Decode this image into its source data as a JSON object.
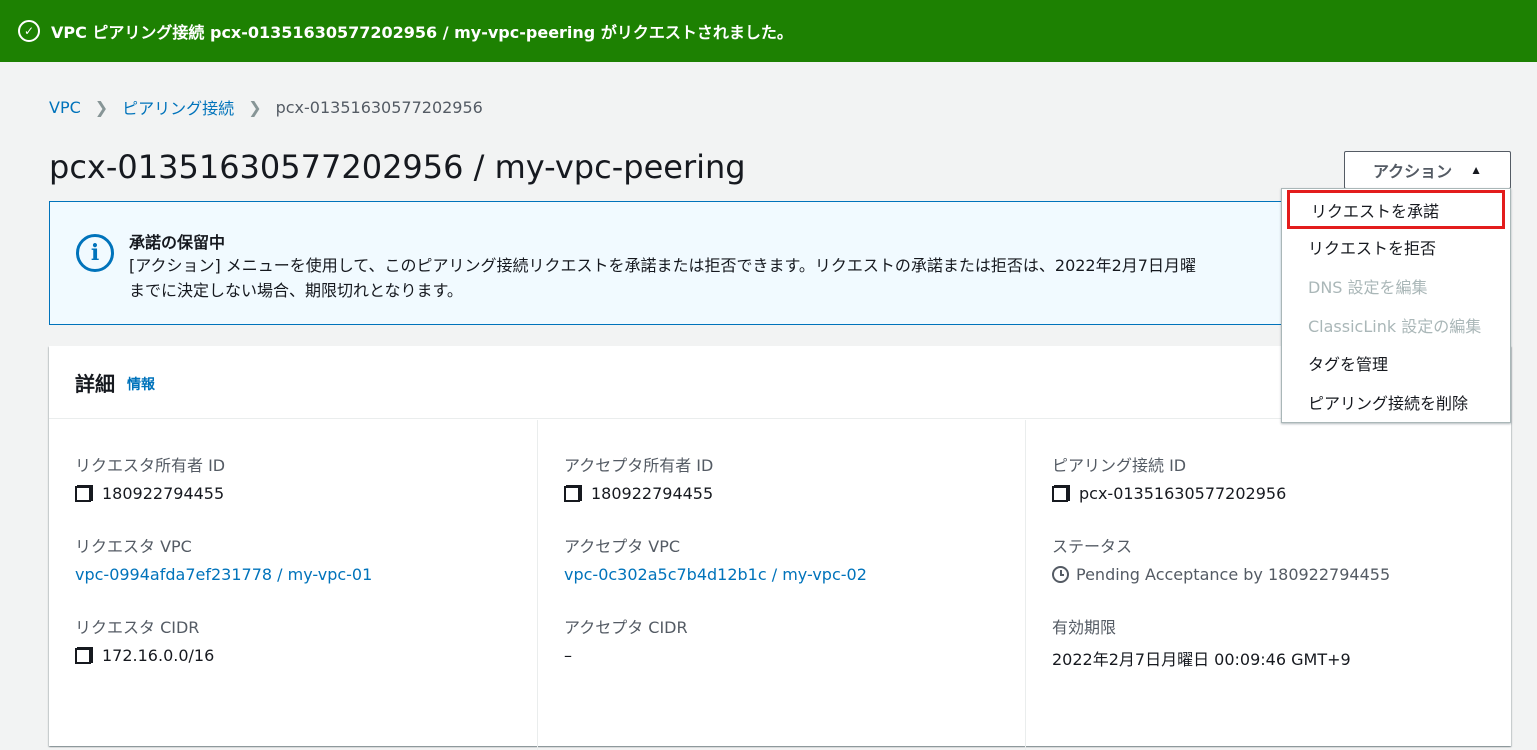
{
  "flash": {
    "message": "VPC ピアリング接続 pcx-01351630577202956 / my-vpc-peering がリクエストされました。",
    "color": "#1d8102"
  },
  "breadcrumb": {
    "items": [
      "VPC",
      "ピアリング接続"
    ],
    "current": "pcx-01351630577202956"
  },
  "page": {
    "title": "pcx-01351630577202956 / my-vpc-peering"
  },
  "actions": {
    "label": "アクション",
    "menu": [
      {
        "label": "リクエストを承諾",
        "enabled": true,
        "highlighted": true
      },
      {
        "label": "リクエストを拒否",
        "enabled": true
      },
      {
        "label": "DNS 設定を編集",
        "enabled": false
      },
      {
        "label": "ClassicLink 設定の編集",
        "enabled": false
      },
      {
        "label": "タグを管理",
        "enabled": true
      },
      {
        "label": "ピアリング接続を削除",
        "enabled": true
      }
    ]
  },
  "info": {
    "title": "承諾の保留中",
    "line1": "[アクション] メニューを使用して、このピアリング接続リクエストを承諾または拒否できます。リクエストの承諾または拒否は、2022年2月7日月曜",
    "line2": "までに決定しない場合、期限切れとなります。"
  },
  "details": {
    "heading": "詳細",
    "info_link": "情報",
    "columns": [
      [
        {
          "label": "リクエスタ所有者 ID",
          "value": "180922794455",
          "icon": "copy-icon"
        },
        {
          "label": "リクエスタ VPC",
          "value": "vpc-0994afda7ef231778 / my-vpc-01",
          "link": true
        },
        {
          "label": "リクエスタ CIDR",
          "value": "172.16.0.0/16",
          "icon": "copy-icon"
        }
      ],
      [
        {
          "label": "アクセプタ所有者 ID",
          "value": "180922794455",
          "icon": "copy-icon"
        },
        {
          "label": "アクセプタ VPC",
          "value": "vpc-0c302a5c7b4d12b1c / my-vpc-02",
          "link": true
        },
        {
          "label": "アクセプタ CIDR",
          "value": "–"
        }
      ],
      [
        {
          "label": "ピアリング接続 ID",
          "value": "pcx-01351630577202956",
          "icon": "copy-icon"
        },
        {
          "label": "ステータス",
          "value": "Pending Acceptance by 180922794455",
          "icon": "clock-icon"
        },
        {
          "label": "有効期限",
          "value": "2022年2月7日月曜日 00:09:46 GMT+9"
        }
      ]
    ]
  }
}
